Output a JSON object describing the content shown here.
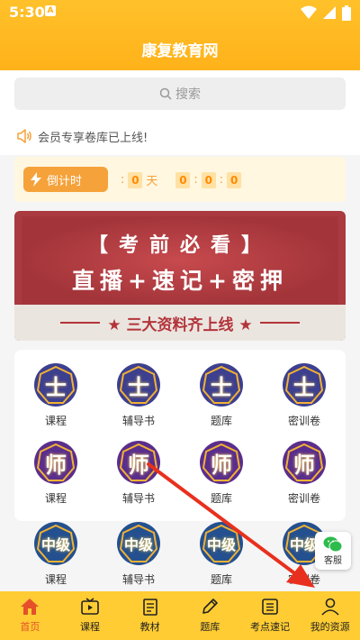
{
  "status": {
    "time": "5:30",
    "badge": "A"
  },
  "header": {
    "title": "康复教育网"
  },
  "search": {
    "placeholder": "搜索",
    "icon": "search-icon"
  },
  "notice": {
    "text": "会员专享卷库已上线!",
    "icon": "speaker-icon"
  },
  "countdown": {
    "label": "倒计时",
    "colon": ":",
    "days": "0",
    "days_unit": "天",
    "hours": "0",
    "minutes": "0",
    "seconds": "0"
  },
  "banner": {
    "top_text": "【考前必看】",
    "main_text": "直播+速记+密押",
    "bottom_text": "★ 三大资料齐上线 ★"
  },
  "grid": {
    "rows": [
      {
        "badge": "士",
        "items": [
          "课程",
          "辅导书",
          "题库",
          "密训卷"
        ]
      },
      {
        "badge": "师",
        "items": [
          "课程",
          "辅导书",
          "题库",
          "密训卷"
        ]
      },
      {
        "badge": "中级",
        "items": [
          "课程",
          "辅导书",
          "题库",
          "密训卷"
        ]
      }
    ]
  },
  "service": {
    "label": "客服",
    "icon": "wechat-icon"
  },
  "tabbar": {
    "items": [
      {
        "label": "首页",
        "icon": "home-icon",
        "active": true
      },
      {
        "label": "课程",
        "icon": "tv-icon",
        "active": false
      },
      {
        "label": "教材",
        "icon": "book-icon",
        "active": false
      },
      {
        "label": "题库",
        "icon": "pencil-icon",
        "active": false
      },
      {
        "label": "考点速记",
        "icon": "list-icon",
        "active": false
      },
      {
        "label": "我的资源",
        "icon": "user-icon",
        "active": false
      }
    ]
  },
  "colors": {
    "header": "#ffb21a",
    "tabbar": "#ffcc33",
    "active_tab": "#e5502a",
    "banner": "#a93a3f",
    "badge_blue": "#3d3f8f",
    "badge_purple": "#5a2e8c",
    "badge_gold": "#f2b233",
    "annotation_arrow": "#e8301e"
  }
}
